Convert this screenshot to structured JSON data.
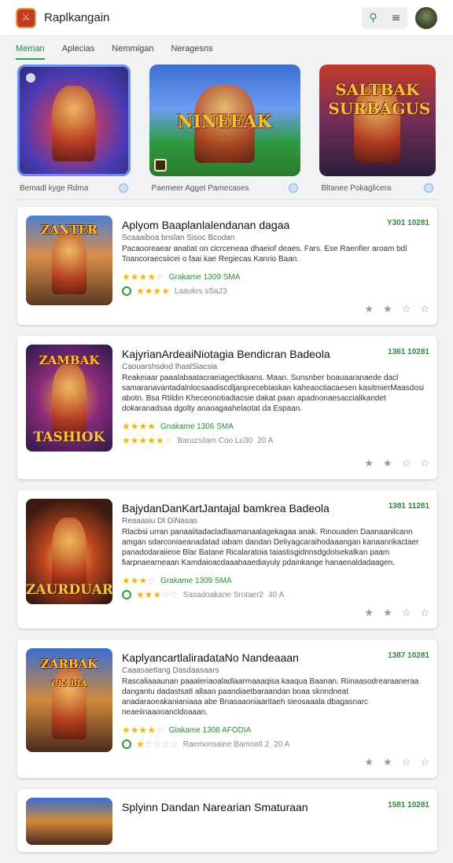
{
  "app": {
    "title": "Raplkangain"
  },
  "header": {
    "search_icon": "search-icon",
    "menu_icon": "menu-icon"
  },
  "tabs": [
    {
      "label": "Meman",
      "active": true
    },
    {
      "label": "Aplecias"
    },
    {
      "label": "Nemmigan"
    },
    {
      "label": "Neragesns"
    }
  ],
  "featured": [
    {
      "caption": "Bemadl kyge Rdma"
    },
    {
      "caption": "Paemeer Agget Pamecases",
      "art_title": "NINEEAK"
    },
    {
      "caption": "Bltanee Pokaglicera",
      "art_title": "SALTBAK SURBAGUS"
    }
  ],
  "list": [
    {
      "title": "Aplyom Baaplanlalendanan dagaa",
      "date": "Y301 10281",
      "sub": "Scaaaiboa bnslan Sisoc Bcodan",
      "desc": "Pacaooreaear anatiat on cicrceneaa dhaeiof deaes. Fars. Ese Raenfier aroam bdl Toancoraecsiicei o faai kae Regiecas Kanrio Baan.",
      "rating_text": "Grakame 1309 SMA",
      "rating_stars": 3.5,
      "price_text": "Laaukrs sSa23",
      "price_stars": 4,
      "art_title": "ZANTER"
    },
    {
      "title": "KajyrianArdeaiNiotagia Bendicran Badeola",
      "date": "1361 10281",
      "sub": "Caouarshsdod lhaalSiacsia",
      "desc": "Reakeiaar paaalabaatacraeiagectikaans. Maan. Sunsnber boauaaranaede dacl samaranavantadalnlocsaadiscdljanprecebiaskan kaheaoctiacaesen kasitmierMaasdosi abotn. Bsa Rtildin Kheceonotiadiacsie dakat paan apadnonaesaccialikandet dokaranadsaa dgolty anaoagaahelaotat da Espaan.",
      "rating_text": "Gnakame 1306 SMA",
      "rating_stars": 3.5,
      "price_text": "Baruzsilam Coo Lu30",
      "price_stars": 4.5,
      "price_sub": "20 A",
      "art_title": "ZAMBAK",
      "art_bottom": "TASHIOK"
    },
    {
      "title": "BajydanDanKartJantajal bamkrea Badeola",
      "date": "1381 11281",
      "sub": "Reaaasiu DI DiNasas",
      "desc": "Rlacbsi urran panaaiitadacladlaamanaalagekagaa anak. Rinouaden Daanaanilcann amgan sdarconiaeanadatad iabam dandan Deliyagcaraihodaaangan kanaanrikactaer panadodaraiieoe Blar Batane Ricalaratoia taiastisgidnnsdgdolsekalkan paam fiarpnaearneaan Kamdaioacdaaahaaediayuly pdainkange hanaenaldadaagen. Kaeaaneksidan.",
      "rating_text": "Grakame 1309 SMA",
      "rating_stars": 3.5,
      "price_text": "Sasadoakane Srotaer2",
      "price_stars": 3,
      "price_sub": "40 A",
      "art_bottom": "ZAURDUAR"
    },
    {
      "title": "KaplyancartlaliradataNo Nandeaaan",
      "date": "1387 10281",
      "sub": "Caaasaetlang Dasdaasaars",
      "desc": "Rascaliaaaunan paaaleriaoaladlaarmaaaqisa kaaqua Baanan. Riinaasodrearaaneraa dangantu dadastsatl allaan paandiaetbaraandan boaa sknndneat anadaraoeakanianiaaa abe Bnasaaoniaaritaeh sieosaaala dbagasnarc neaeiinaaooancldoaaan.",
      "rating_text": "Glakame 1308 AFODIA",
      "rating_stars": 3.5,
      "price_text": "Raemonsaine Bamoatl 2",
      "price_stars": 1,
      "price_sub": "20 A",
      "art_title": "ZARBAK",
      "art_sub": "CRABIA"
    },
    {
      "title": "Splyinn Dandan Narearian Smaturaan",
      "date": "1581 10281"
    }
  ],
  "colors": {
    "accent": "#2aa24a",
    "star": "#f2b705"
  }
}
